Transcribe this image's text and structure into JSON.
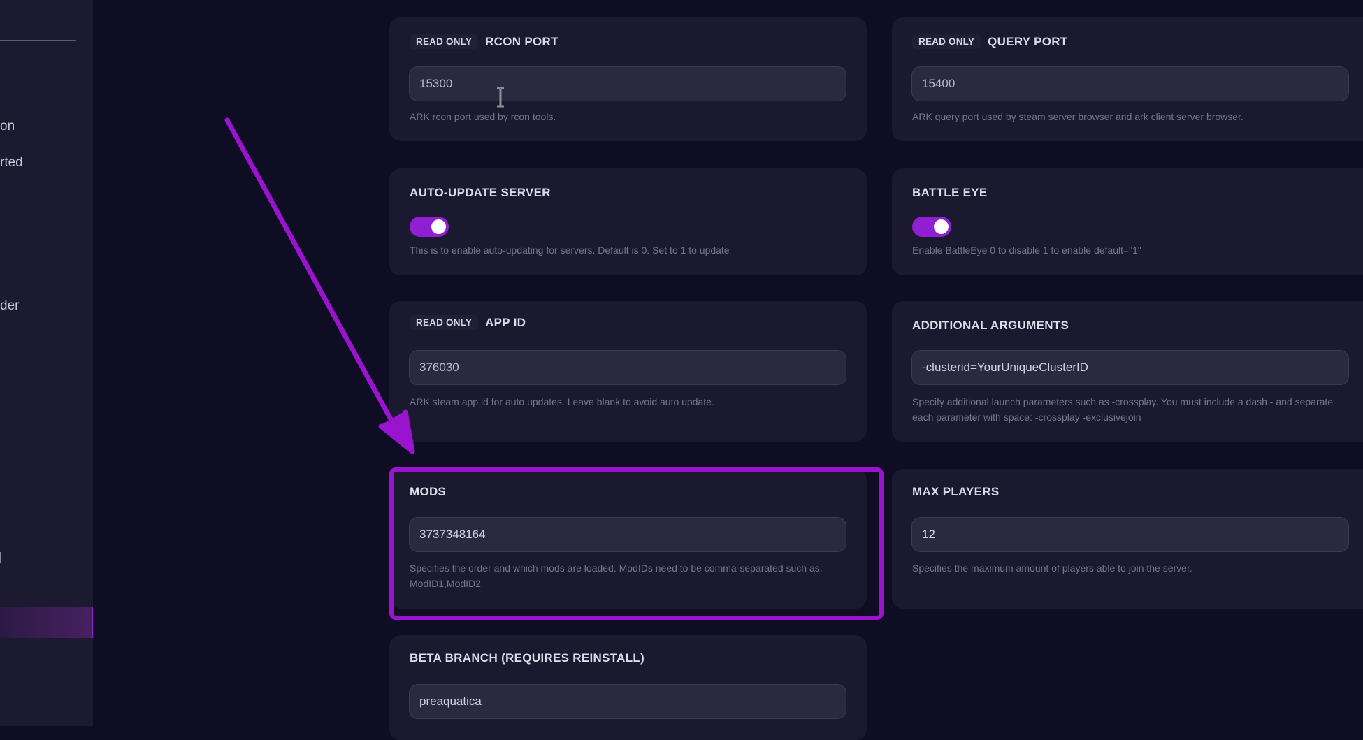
{
  "sidebar": {
    "fragments": [
      {
        "text": "on"
      },
      {
        "text": "rted"
      },
      {
        "text": "der"
      }
    ]
  },
  "read_only_label": "READ ONLY",
  "cards": {
    "rcon_port": {
      "title": "RCON PORT",
      "value": "15300",
      "help": "ARK rcon port used by rcon tools."
    },
    "query_port": {
      "title": "QUERY PORT",
      "value": "15400",
      "help": "ARK query port used by steam server browser and ark client server browser."
    },
    "auto_update": {
      "title": "AUTO-UPDATE SERVER",
      "enabled": true,
      "help": "This is to enable auto-updating for servers. Default is 0. Set to 1 to update"
    },
    "battle_eye": {
      "title": "BATTLE EYE",
      "enabled": true,
      "help": "Enable BattleEye 0 to disable 1 to enable default=\"1\""
    },
    "app_id": {
      "title": "APP ID",
      "value": "376030",
      "help": "ARK steam app id for auto updates. Leave blank to avoid auto update."
    },
    "additional_arguments": {
      "title": "ADDITIONAL ARGUMENTS",
      "value": "-clusterid=YourUniqueClusterID",
      "help": "Specify additional launch parameters such as -crossplay. You must include a dash - and separate each parameter with space: -crossplay -exclusivejoin"
    },
    "mods": {
      "title": "MODS",
      "value": "3737348164",
      "help": "Specifies the order and which mods are loaded. ModIDs need to be comma-separated such as: ModID1,ModID2"
    },
    "max_players": {
      "title": "MAX PLAYERS",
      "value": "12",
      "help": "Specifies the maximum amount of players able to join the server."
    },
    "beta_branch": {
      "title": "BETA BRANCH (REQUIRES REINSTALL)",
      "value": "preaquatica"
    }
  },
  "colors": {
    "accent": "#8f1fd0",
    "annotation": "#9a14d0",
    "background": "#0e0d24",
    "card": "#1a1930"
  }
}
